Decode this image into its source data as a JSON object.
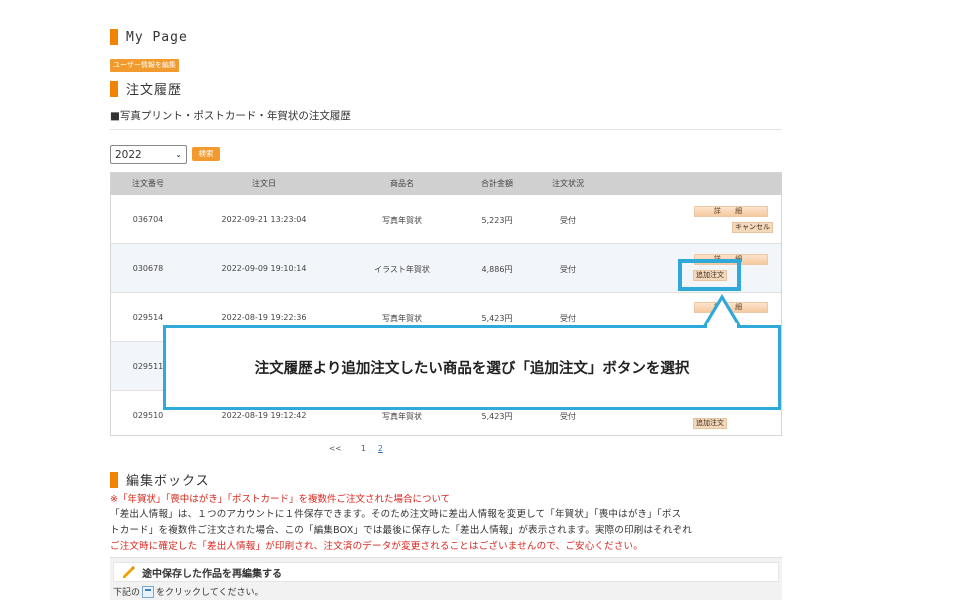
{
  "mypage": {
    "title": "My Page",
    "edit_user_label": "ユーザー情報を編集"
  },
  "order_history": {
    "title": "注文履歴",
    "subheading": "■写真プリント・ポストカード・年賀状の注文履歴",
    "year_value": "2022",
    "search_label": "検索",
    "columns": [
      "注文番号",
      "注文日",
      "商品名",
      "合計金額",
      "注文状況"
    ],
    "rows": [
      {
        "id": "036704",
        "date": "2022-09-21 13:23:04",
        "product": "写真年賀状",
        "total": "5,223円",
        "status": "受付"
      },
      {
        "id": "030678",
        "date": "2022-09-09 19:10:14",
        "product": "イラスト年賀状",
        "total": "4,886円",
        "status": "受付"
      },
      {
        "id": "029514",
        "date": "2022-08-19 19:22:36",
        "product": "写真年賀状",
        "total": "5,423円",
        "status": "受付"
      },
      {
        "id": "029511",
        "date": "",
        "product": "",
        "total": "",
        "status": ""
      },
      {
        "id": "029510",
        "date": "2022-08-19 19:12:42",
        "product": "写真年賀状",
        "total": "5,423円",
        "status": "受付"
      }
    ],
    "detail_label": "詳 細",
    "cancel_label": "キャンセル",
    "add_order_label": "追加注文"
  },
  "pagination": {
    "prev": "<<",
    "page1": "1",
    "page2": "2"
  },
  "callout": {
    "text": "注文履歴より追加注文したい商品を選び「追加注文」ボタンを選択"
  },
  "edit_box": {
    "title": "編集ボックス",
    "notice_title": "※「年賀状」「喪中はがき」「ポストカード」を複数件ご注文された場合について",
    "notice_line1": "「差出人情報」は、１つのアカウントに１件保存できます。そのため注文時に差出人情報を変更して「年賀状」「喪中はがき」「ポス",
    "notice_line2": "トカード」を複数件ご注文された場合、この「編集BOX」では最後に保存した「差出人情報」が表示されます。実際の印刷はそれぞれ",
    "notice_line3": "ご注文時に確定した「差出人情報」が印刷され、注文済のデータが変更されることはございませんので、ご安心ください。",
    "saved_title": "途中保存した作品を再編集する",
    "click_prefix": "下記の",
    "click_suffix": "をクリックしてください。"
  },
  "colors": {
    "accent": "#f08300",
    "button": "#f29a2e",
    "highlight": "#2ea9d9",
    "notice": "#d9261c"
  }
}
